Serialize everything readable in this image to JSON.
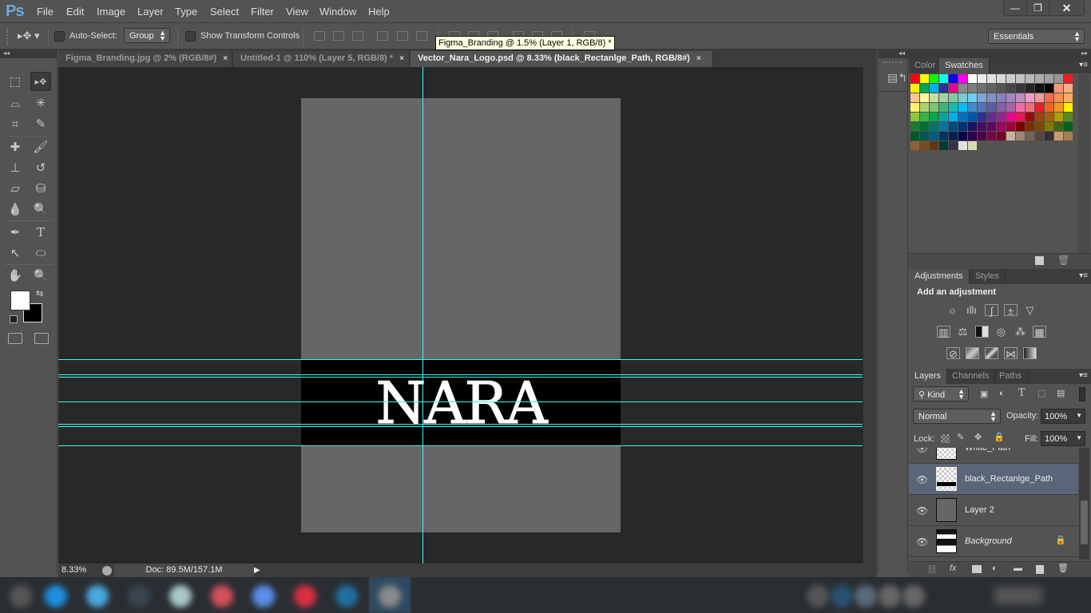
{
  "app": {
    "logo": "Ps",
    "menu": [
      "File",
      "Edit",
      "Image",
      "Layer",
      "Type",
      "Select",
      "Filter",
      "View",
      "Window",
      "Help"
    ],
    "window_buttons": {
      "minimize": "—",
      "restore": "❐",
      "close": "✕"
    }
  },
  "options_bar": {
    "auto_select_label": "Auto-Select:",
    "auto_select_checked": false,
    "auto_select_target": "Group",
    "show_transform_label": "Show Transform Controls",
    "show_transform_checked": false,
    "workspace": "Essentials"
  },
  "tooltip": "Figma_Branding @ 1.5% (Layer 1, RGB/8) *",
  "tabs": [
    {
      "label": "Figma_Branding.jpg @ 2% (RGB/8#)",
      "active": false
    },
    {
      "label": "Untitled-1 @ 110% (Layer 5, RGB/8) *",
      "active": false
    },
    {
      "label": "Vector_Nara_Logo.psd @ 8.33% (black_Rectanlge_Path, RGB/8#)",
      "active": true
    }
  ],
  "tab_close": "×",
  "canvas": {
    "logo_text": "NARA"
  },
  "status": {
    "zoom": "8.33%",
    "doc_info": "Doc: 89.5M/157.1M"
  },
  "toolbar": {
    "tools": [
      {
        "name": "rectangular-marquee-tool",
        "glyph": "⬚"
      },
      {
        "name": "move-tool",
        "glyph": "▸✥",
        "active": true
      },
      {
        "name": "polygonal-lasso-tool",
        "glyph": "⌓"
      },
      {
        "name": "magic-wand-tool",
        "glyph": "✳"
      },
      {
        "name": "crop-tool",
        "glyph": "⌗"
      },
      {
        "name": "eyedropper-tool",
        "glyph": "✎"
      },
      {
        "name": "spot-healing-brush-tool",
        "glyph": "✚"
      },
      {
        "name": "brush-tool",
        "glyph": "🖌"
      },
      {
        "name": "clone-stamp-tool",
        "glyph": "⊥"
      },
      {
        "name": "history-brush-tool",
        "glyph": "↺"
      },
      {
        "name": "eraser-tool",
        "glyph": "▱"
      },
      {
        "name": "paint-bucket-tool",
        "glyph": "⛁"
      },
      {
        "name": "blur-tool",
        "glyph": "💧"
      },
      {
        "name": "dodge-tool",
        "glyph": "🔍"
      },
      {
        "name": "pen-tool",
        "glyph": "✒"
      },
      {
        "name": "type-tool",
        "glyph": "T"
      },
      {
        "name": "path-selection-tool",
        "glyph": "↖"
      },
      {
        "name": "ellipse-tool",
        "glyph": "⬭"
      },
      {
        "name": "hand-tool",
        "glyph": "✋"
      },
      {
        "name": "zoom-tool",
        "glyph": "🔍"
      }
    ],
    "foreground_color": "#ffffff",
    "background_color": "#000000"
  },
  "panels": {
    "color_tabs": [
      {
        "label": "Color",
        "active": false
      },
      {
        "label": "Swatches",
        "active": true
      }
    ],
    "swatches": [
      [
        "#ff0000",
        "#ffff00",
        "#00ff00",
        "#00ffff",
        "#0000ff",
        "#ff00ff",
        "#ffffff",
        "#ebebeb",
        "#e1e1e1",
        "#d7d7d7",
        "#cccccc",
        "#c2c2c2",
        "#b7b7b7",
        "#acacac",
        "#a0a0a0",
        "#959595",
        "#ee1c25"
      ],
      [
        "#fff200",
        "#00a651",
        "#00aeef",
        "#2e3192",
        "#ec008c",
        "#898989",
        "#7d7d7d",
        "#707070",
        "#626262",
        "#555555",
        "#464646",
        "#363636",
        "#262626",
        "#111111",
        "#000000",
        "#f7977a",
        "#fbad82"
      ],
      [
        "#fdc68c",
        "#fff799",
        "#c6df9c",
        "#a4d49d",
        "#81ca9d",
        "#7bcdc9",
        "#6ccff7",
        "#7ca6d8",
        "#8293ca",
        "#8881be",
        "#a286bd",
        "#bc8cbf",
        "#f49bc1",
        "#f5999d",
        "#f26c4f",
        "#f68e55",
        "#fbaf5a"
      ],
      [
        "#fff467",
        "#acd372",
        "#7dc473",
        "#39b778",
        "#17bcb4",
        "#00bef2",
        "#438ccb",
        "#5573b7",
        "#5e5ca7",
        "#855fa8",
        "#a763a9",
        "#ef6ea8",
        "#f16d7e",
        "#ee1d24",
        "#f16522",
        "#f7941d",
        "#fff100"
      ],
      [
        "#8fc63d",
        "#37b44a",
        "#00a650",
        "#00a99e",
        "#00aeef",
        "#0072bc",
        "#0054a5",
        "#2f3090",
        "#662d91",
        "#92278f",
        "#ec008c",
        "#ed145a",
        "#9d0a0e",
        "#a0410d",
        "#a3620a",
        "#aba000",
        "#598527"
      ],
      [
        "#1a7b30",
        "#007236",
        "#00736a",
        "#0076a4",
        "#004a80",
        "#003370",
        "#1d1363",
        "#450e61",
        "#62055f",
        "#9e005c",
        "#9d0039",
        "#790000",
        "#7b2e00",
        "#7d4900",
        "#827a00",
        "#3e6617",
        "#045f20"
      ],
      [
        "#005824",
        "#005951",
        "#005b7e",
        "#003562",
        "#002056",
        "#0c004b",
        "#30004a",
        "#4b0048",
        "#7a0045",
        "#7a0026",
        "#c7b299",
        "#998675",
        "#736357",
        "#534741",
        "#362f2d",
        "#c69c6d",
        "#a67c52"
      ],
      [
        "#8c6239",
        "#754c24",
        "#603813",
        "#003c33",
        "#3c2e48",
        "#e0e0e0",
        "#d9d9b7"
      ]
    ],
    "adjustments_tabs": [
      {
        "label": "Adjustments",
        "active": true
      },
      {
        "label": "Styles",
        "active": false
      }
    ],
    "adjustments_title": "Add an adjustment",
    "adjustment_icons": [
      [
        "brightness-contrast",
        "levels",
        "curves",
        "exposure",
        "gradient-triangle"
      ],
      [
        "vibrance",
        "color-balance",
        "black-white",
        "photo-filter",
        "channel-mixer",
        "color-lookup"
      ],
      [
        "invert",
        "posterize",
        "threshold",
        "selective-color",
        "gradient-map"
      ]
    ],
    "layers_tabs": [
      {
        "label": "Layers",
        "active": true
      },
      {
        "label": "Channels",
        "active": false
      },
      {
        "label": "Paths",
        "active": false
      }
    ],
    "filter_kind": "Kind",
    "blend_mode": "Normal",
    "opacity_label": "Opacity:",
    "opacity": "100%",
    "lock_label": "Lock:",
    "fill_label": "Fill:",
    "fill": "100%",
    "layers": [
      {
        "name": "White_Path",
        "visible": true,
        "selected": false,
        "locked": false,
        "italic": false
      },
      {
        "name": "black_Rectanlge_Path",
        "visible": true,
        "selected": true,
        "locked": false,
        "italic": false
      },
      {
        "name": "Layer 2",
        "visible": true,
        "selected": false,
        "locked": false,
        "italic": false
      },
      {
        "name": "Background",
        "visible": true,
        "selected": false,
        "locked": true,
        "italic": true
      }
    ]
  }
}
